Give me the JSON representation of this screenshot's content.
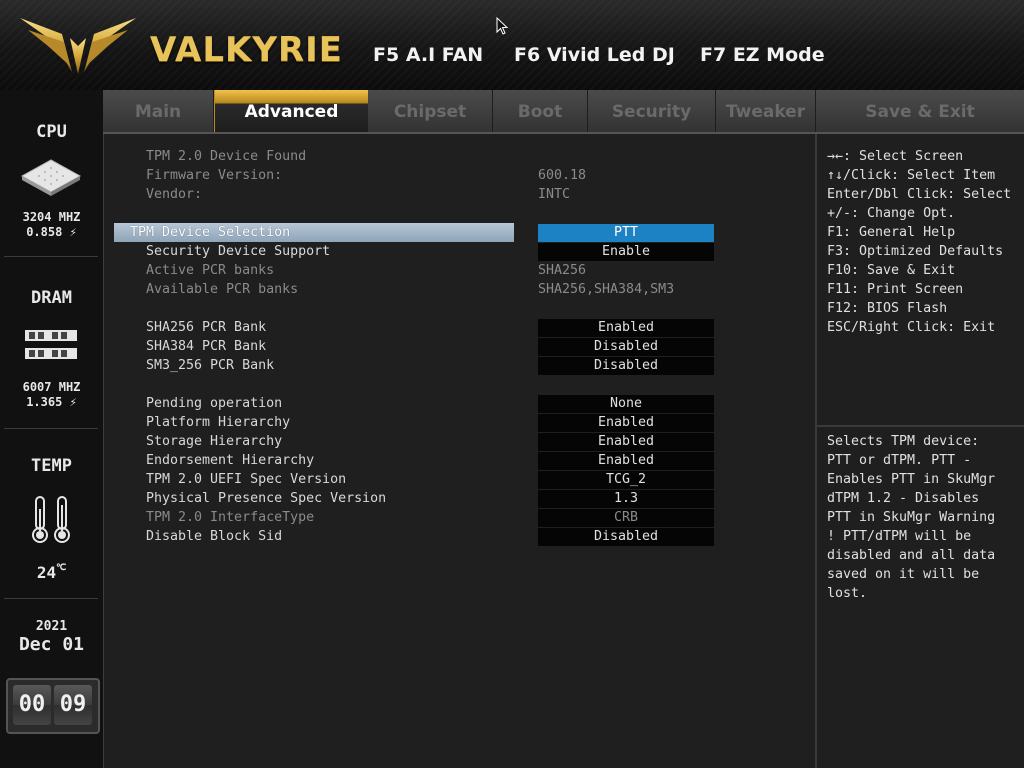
{
  "header": {
    "brand": "VALKYRIE",
    "hotkeys": [
      "F5 A.I FAN",
      "F6 Vivid Led DJ",
      "F7 EZ Mode"
    ]
  },
  "tabs": [
    {
      "label": "Main",
      "active": false
    },
    {
      "label": "Advanced",
      "active": true
    },
    {
      "label": "Chipset",
      "active": false
    },
    {
      "label": "Boot",
      "active": false
    },
    {
      "label": "Security",
      "active": false
    },
    {
      "label": "Tweaker",
      "active": false
    },
    {
      "label": "Save & Exit",
      "active": false
    }
  ],
  "sidebar": {
    "cpu": {
      "title": "CPU",
      "freq": "3204 MHZ",
      "volt": "0.858"
    },
    "dram": {
      "title": "DRAM",
      "freq": "6007 MHZ",
      "volt": "1.365"
    },
    "temp": {
      "title": "TEMP",
      "value": "24"
    },
    "date": {
      "year": "2021",
      "month": "Dec",
      "day": "01"
    },
    "clock": {
      "hours": "00",
      "minutes": "09"
    }
  },
  "info": {
    "device_found": "TPM 2.0 Device Found",
    "firmware_label": "Firmware Version:",
    "firmware_value": "600.18",
    "vendor_label": "Vendor:",
    "vendor_value": "INTC"
  },
  "settings": [
    {
      "label": "TPM Device Selection",
      "value": "PTT"
    },
    {
      "label": "Security Device Support",
      "value": "Enable"
    },
    {
      "label": "Active PCR banks",
      "value": "SHA256"
    },
    {
      "label": "Available PCR banks",
      "value": "SHA256,SHA384,SM3"
    },
    {
      "label": "SHA256 PCR Bank",
      "value": "Enabled"
    },
    {
      "label": "SHA384 PCR Bank",
      "value": "Disabled"
    },
    {
      "label": "SM3_256 PCR Bank",
      "value": "Disabled"
    },
    {
      "label": "Pending operation",
      "value": "None"
    },
    {
      "label": "Platform Hierarchy",
      "value": "Enabled"
    },
    {
      "label": "Storage Hierarchy",
      "value": "Enabled"
    },
    {
      "label": "Endorsement Hierarchy",
      "value": "Enabled"
    },
    {
      "label": "TPM 2.0 UEFI Spec Version",
      "value": "TCG_2"
    },
    {
      "label": "Physical Presence Spec Version",
      "value": "1.3"
    },
    {
      "label": "TPM 2.0 InterfaceType",
      "value": "CRB"
    },
    {
      "label": "Disable Block Sid",
      "value": "Disabled"
    }
  ],
  "help": {
    "keys": [
      "→←: Select Screen",
      "↑↓/Click: Select Item",
      "Enter/Dbl Click: Select",
      "+/-: Change Opt.",
      "F1: General Help",
      "F3: Optimized Defaults",
      "F10: Save & Exit",
      "F11: Print Screen",
      "F12: BIOS Flash",
      "ESC/Right Click: Exit"
    ],
    "description": [
      "Selects TPM device:",
      "PTT or dTPM. PTT -",
      "Enables PTT in SkuMgr",
      "dTPM 1.2 - Disables",
      "PTT in SkuMgr Warning",
      "!  PTT/dTPM will be",
      "disabled and all data",
      "saved on it will be",
      "lost."
    ]
  },
  "colors": {
    "gold": "#e8c25a",
    "selected_value": "#1c82c4",
    "background": "#1f1f1f"
  }
}
